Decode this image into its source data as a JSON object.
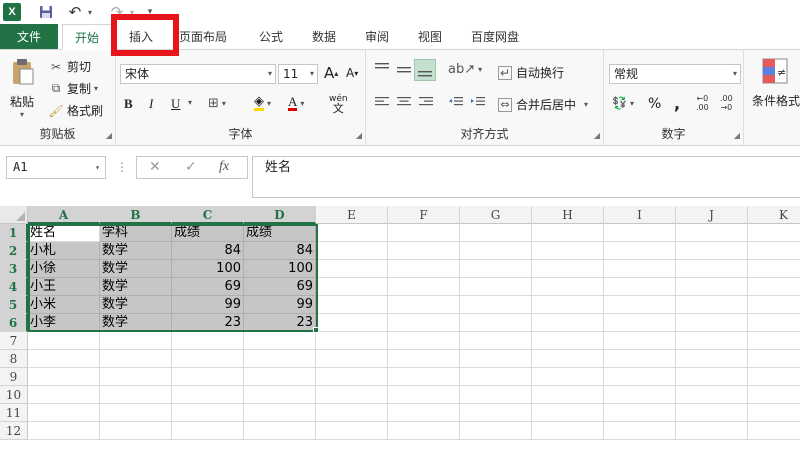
{
  "qat": {
    "app_icon": "X",
    "icons": [
      "excel-icon",
      "save-icon",
      "undo-icon",
      "redo-icon",
      "customize-qat-icon"
    ]
  },
  "tabs": [
    {
      "label": "文件"
    },
    {
      "label": "开始"
    },
    {
      "label": "插入"
    },
    {
      "label": "页面布局"
    },
    {
      "label": "公式"
    },
    {
      "label": "数据"
    },
    {
      "label": "审阅"
    },
    {
      "label": "视图"
    },
    {
      "label": "百度网盘"
    }
  ],
  "ribbon": {
    "clipboard": {
      "paste": "粘贴",
      "cut": "剪切",
      "copy": "复制",
      "format_painter": "格式刷",
      "group_label": "剪贴板"
    },
    "font": {
      "font_name": "宋体",
      "font_size": "11",
      "grow": "A",
      "shrink": "A",
      "bold": "B",
      "italic": "I",
      "underline": "U",
      "font_color_letter": "A",
      "phonetic": "wén",
      "group_label": "字体"
    },
    "alignment": {
      "wrap_text": "自动换行",
      "merge_center": "合并后居中",
      "group_label": "对齐方式"
    },
    "number": {
      "format": "常规",
      "percent": "%",
      "comma": ",",
      "inc_decimal_top": "←0",
      "inc_decimal_bot": ".00",
      "dec_decimal_top": ".00",
      "dec_decimal_bot": "→0",
      "group_label": "数字"
    },
    "styles": {
      "conditional_format": "条件格式"
    }
  },
  "formula_bar": {
    "name_box": "A1",
    "cancel": "✕",
    "enter": "✓",
    "fx": "fx",
    "content": "姓名"
  },
  "grid": {
    "columns": [
      "A",
      "B",
      "C",
      "D",
      "E",
      "F",
      "G",
      "H",
      "I",
      "J",
      "K"
    ],
    "selected_columns": [
      "A",
      "B",
      "C",
      "D"
    ],
    "rows": [
      "1",
      "2",
      "3",
      "4",
      "5",
      "6",
      "7",
      "8",
      "9",
      "10",
      "11",
      "12"
    ],
    "selected_rows": [
      "1",
      "2",
      "3",
      "4",
      "5",
      "6"
    ],
    "data": [
      [
        "姓名",
        "学科",
        "成绩",
        "成绩"
      ],
      [
        "小札",
        "数学",
        "84",
        "84"
      ],
      [
        "小徐",
        "数学",
        "100",
        "100"
      ],
      [
        "小王",
        "数学",
        "69",
        "69"
      ],
      [
        "小米",
        "数学",
        "99",
        "99"
      ],
      [
        "小李",
        "数学",
        "23",
        "23"
      ]
    ]
  },
  "colors": {
    "accent": "#217346",
    "highlight": "#e8141c",
    "selection": "#c6c6c6"
  }
}
